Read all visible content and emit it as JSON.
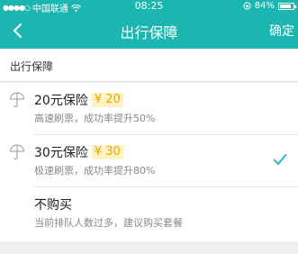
{
  "status_bar": {
    "carrier": "中国联通",
    "time": "08:25",
    "battery": "84%"
  },
  "nav": {
    "title": "出行保障",
    "confirm": "确定"
  },
  "section": {
    "title": "出行保障"
  },
  "options": [
    {
      "title": "20元保险",
      "price": "¥ 20",
      "desc": "高速刷票，成功率提升50%",
      "icon": "umbrella-icon",
      "selected": false
    },
    {
      "title": "30元保险",
      "price": "¥ 30",
      "desc": "极速刷票，成功率提升80%",
      "icon": "umbrella-icon",
      "selected": true
    },
    {
      "title": "不购买",
      "desc": "当前排队人数过多，建议购买套餐",
      "selected": false
    }
  ],
  "colors": {
    "accent": "#1bb6b0",
    "price_text": "#f0a500",
    "price_bg": "#fdf2c4"
  }
}
